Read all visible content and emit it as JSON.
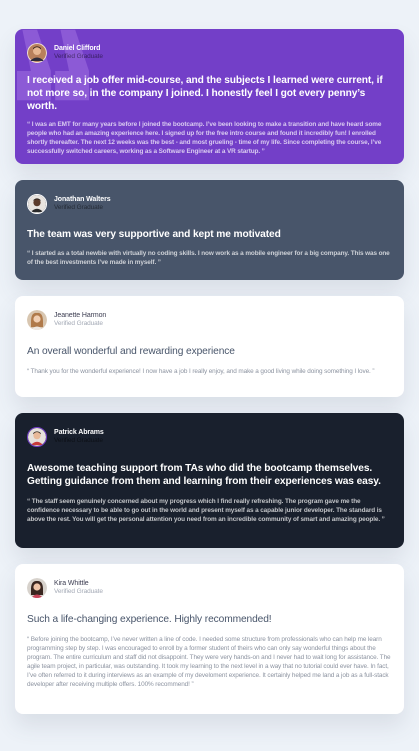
{
  "colors": {
    "page_background": "#edf2f8",
    "purple": "#733fc8",
    "grayish_blue": "#48556a",
    "white": "#ffffff",
    "blackish_blue": "#19202d",
    "quote_mark": "#8c5ad6"
  },
  "testimonials": [
    {
      "theme": "purple",
      "avatar_icon": "person-avatar-icon",
      "name": "Daniel Clifford",
      "role": "Verified Graduate",
      "headline": "I received a job offer mid-course, and the subjects I learned were current, if not more so, in the company I joined. I honestly feel I got every penny’s worth.",
      "body": "“ I was an EMT for many years before I joined the bootcamp. I’ve been looking to make a transition and have heard some people who had an amazing experience here. I signed up for the free intro course and found it incredibly fun! I enrolled shortly thereafter. The next 12 weeks was the best - and most grueling - time of my life. Since completing the course, I’ve successfully switched careers, working as a Software Engineer at a VR startup. ”"
    },
    {
      "theme": "grayish-blue",
      "avatar_icon": "person-avatar-icon",
      "name": "Jonathan Walters",
      "role": "Verified Graduate",
      "headline": "The team was very supportive and kept me motivated",
      "body": "“ I started as a total newbie with virtually no coding skills. I now work as a mobile engineer for a big company. This was one of the best investments I’ve made in myself. ”"
    },
    {
      "theme": "white",
      "avatar_icon": "person-avatar-icon",
      "name": "Jeanette Harmon",
      "role": "Verified Graduate",
      "headline": "An overall wonderful and rewarding experience",
      "body": "“ Thank you for the wonderful experience! I now have a job I really enjoy, and make a good living while doing something I love. ”"
    },
    {
      "theme": "blackish-blue",
      "avatar_icon": "person-avatar-icon",
      "name": "Patrick Abrams",
      "role": "Verified Graduate",
      "headline": "Awesome teaching support from TAs who did the bootcamp themselves. Getting guidance from them and learning from their experiences was easy.",
      "body": "“ The staff seem genuinely concerned about my progress which I find really refreshing. The program gave me the confidence necessary to be able to go out in the world and present myself as a capable junior developer. The standard is above the rest. You will get the personal attention you need from an incredible community of smart and amazing people. ”"
    },
    {
      "theme": "white",
      "avatar_icon": "person-avatar-icon",
      "name": "Kira Whittle",
      "role": "Verified Graduate",
      "headline": "Such a life-changing experience. Highly recommended!",
      "body": "“ Before joining the bootcamp, I’ve never written a line of code. I needed some structure from professionals who can help me learn programming step by step. I was encouraged to enroll by a former student of theirs who can only say wonderful things about the program. The entire curriculum and staff did not disappoint. They were very hands-on and I never had to wait long for assistance. The agile team project, in particular, was outstanding. It took my learning to the next level in a way that no tutorial could ever have. In fact, I’ve often referred to it during interviews as an example of my develoment experience. It certainly helped me land a job as a full-stack developer after receiving multiple offers. 100% recommend! ”"
    }
  ]
}
